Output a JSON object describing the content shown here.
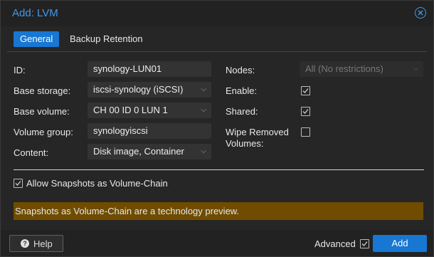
{
  "window": {
    "title": "Add: LVM"
  },
  "tabs": [
    "General",
    "Backup Retention"
  ],
  "left_fields": [
    {
      "label": "ID:",
      "value": "synology-LUN01"
    },
    {
      "label": "Base storage:",
      "value": "iscsi-synology (iSCSI)"
    },
    {
      "label": "Base volume:",
      "value": "CH 00 ID 0 LUN 1"
    },
    {
      "label": "Volume group:",
      "value": "synologyiscsi"
    },
    {
      "label": "Content:",
      "value": "Disk image, Container"
    }
  ],
  "right_fields": {
    "nodes_label": "Nodes:",
    "nodes_value": "All (No restrictions)",
    "enable_label": "Enable:",
    "enable_checked": true,
    "shared_label": "Shared:",
    "shared_checked": true,
    "wipe_label_line1": "Wipe Removed",
    "wipe_label_line2": "Volumes:",
    "wipe_checked": false
  },
  "snapshot_option": {
    "label": "Allow Snapshots as Volume-Chain",
    "checked": true
  },
  "warning": "Snapshots as Volume-Chain are a technology preview.",
  "footer": {
    "help_label": "Help",
    "advanced_label": "Advanced",
    "advanced_checked": true,
    "add_label": "Add"
  },
  "colors": {
    "accent": "#1777d2",
    "title": "#3f9ae8",
    "warning_bg": "#6f4c00"
  }
}
